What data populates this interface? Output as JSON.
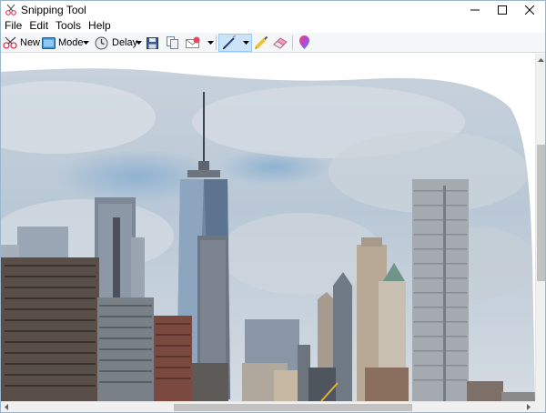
{
  "window": {
    "title": "Snipping Tool",
    "icon": "scissors-icon"
  },
  "menu": [
    "File",
    "Edit",
    "Tools",
    "Help"
  ],
  "toolbar": {
    "new_label": "New",
    "mode_label": "Mode",
    "delay_label": "Delay",
    "icons": [
      "new-snip-icon",
      "mode-icon",
      "delay-clock-icon",
      "save-icon",
      "copy-icon",
      "send-email-icon",
      "pen-icon",
      "highlighter-icon",
      "eraser-icon",
      "paint3d-icon"
    ]
  },
  "colors": {
    "accent": "#0078d7",
    "pen_selected_bg": "#cce4f7",
    "sky": "#b9c6d3",
    "buildings": "#5a5e66"
  }
}
